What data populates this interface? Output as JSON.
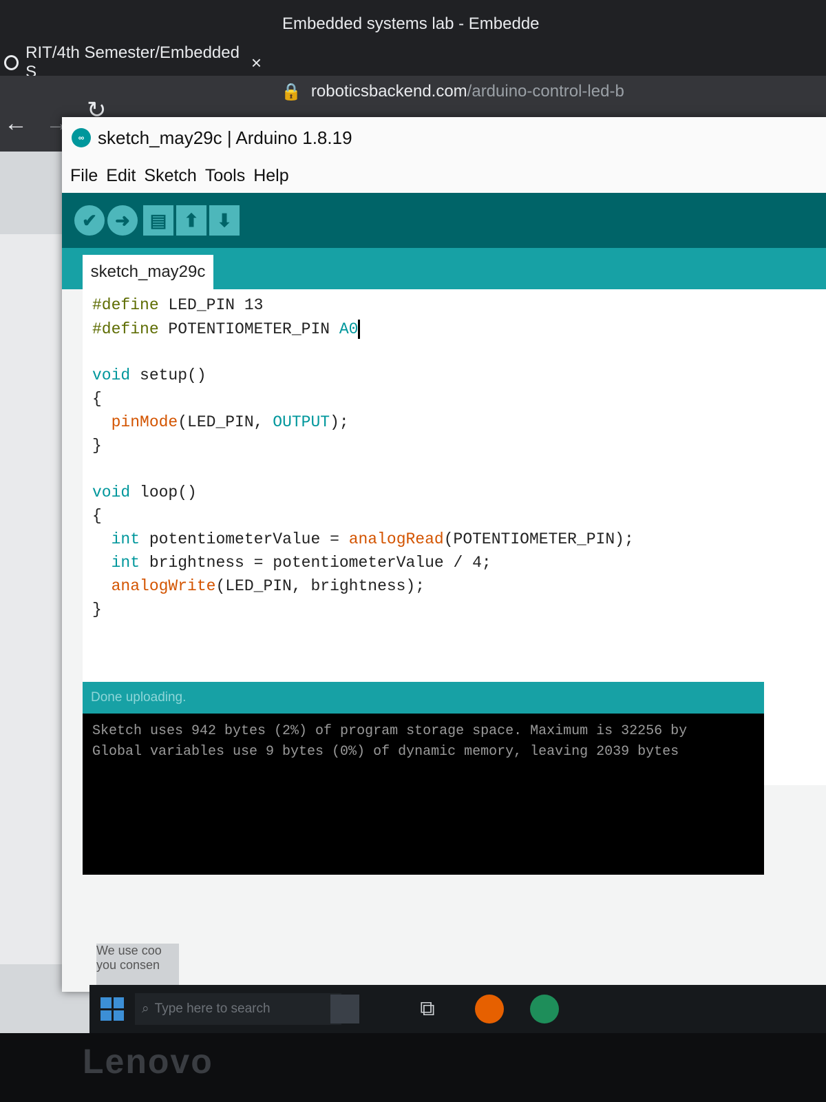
{
  "browser": {
    "tabs": [
      {
        "label": "RIT/4th Semester/Embedded S",
        "close": "×"
      },
      {
        "label": "Embedded systems lab - Embedde"
      }
    ],
    "url": {
      "host": "roboticsbackend.com",
      "path": "/arduino-control-led-b"
    }
  },
  "window": {
    "title": "sketch_may29c | Arduino 1.8.19",
    "logo_text": "∞"
  },
  "menu": [
    "File",
    "Edit",
    "Sketch",
    "Tools",
    "Help"
  ],
  "toolbar": {
    "verify_icon": "check-icon",
    "upload_icon": "arrow-right-icon",
    "new_icon": "new-file-icon",
    "open_icon": "arrow-up-icon",
    "save_icon": "arrow-down-icon"
  },
  "sketch_tab": "sketch_may29c",
  "code": {
    "line1": {
      "directive": "#define",
      "rest": " LED_PIN 13"
    },
    "line2": {
      "directive": "#define",
      "rest": " POTENTIOMETER_PIN ",
      "value": "A0"
    },
    "line4": {
      "type": "void",
      "rest": " setup()"
    },
    "line5": "{",
    "line6": {
      "fn": "pinMode",
      "args1": "(LED_PIN, ",
      "const": "OUTPUT",
      "args2": ");"
    },
    "line7": "}",
    "line9": {
      "type": "void",
      "rest": " loop()"
    },
    "line10": "{",
    "line11": {
      "type": "int",
      "rest": " potentiometerValue = ",
      "fn": "analogRead",
      "args": "(POTENTIOMETER_PIN);"
    },
    "line12": {
      "type": "int",
      "rest": " brightness = potentiometerValue / 4;"
    },
    "line13": {
      "fn": "analogWrite",
      "args": "(LED_PIN, brightness);"
    },
    "line14": "}"
  },
  "console": {
    "status": "Done uploading.",
    "line1": "Sketch uses 942 bytes (2%) of program storage space. Maximum is 32256 by",
    "line2": "Global variables use 9 bytes (0%) of dynamic memory, leaving 2039 bytes"
  },
  "cookie": {
    "line1": "We use coo",
    "line2": "you consen"
  },
  "taskbar": {
    "search_placeholder": "Type here to search"
  },
  "monitor_brand": "Lenovo",
  "colors": {
    "arduino_teal_dark": "#006468",
    "arduino_teal": "#17a1a5",
    "keyword": "#00979c",
    "function": "#d35400",
    "directive": "#5e6d03"
  }
}
